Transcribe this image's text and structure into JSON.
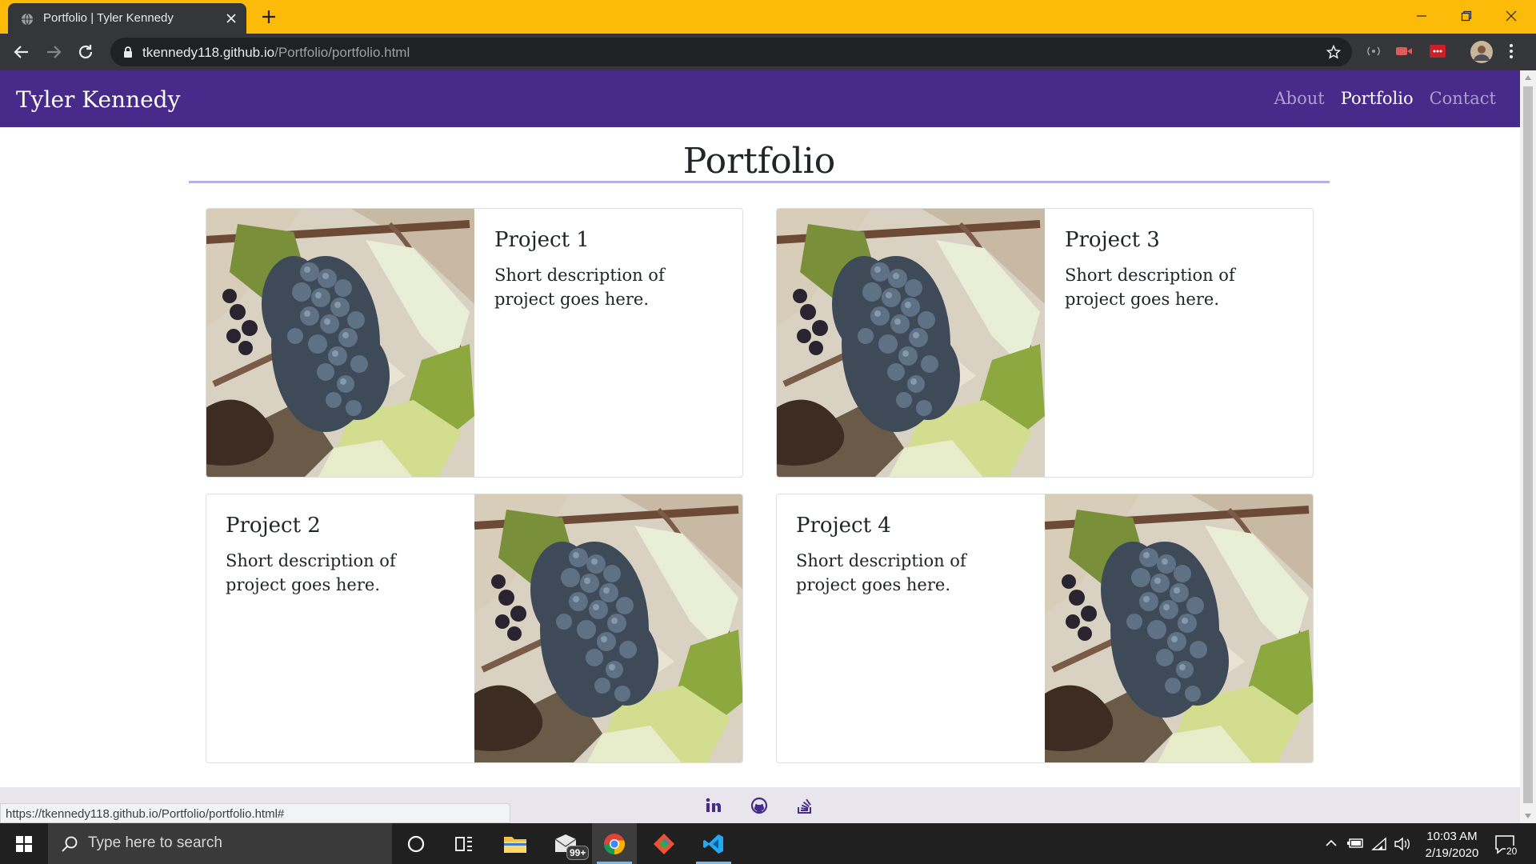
{
  "browser": {
    "tab_title": "Portfolio | Tyler Kennedy",
    "url_host": "tkennedy118.github.io",
    "url_path": "/Portfolio/portfolio.html",
    "theme_color": "#fcbb08",
    "status_url": "https://tkennedy118.github.io/Portfolio/portfolio.html#"
  },
  "site": {
    "brand": "Tyler Kennedy",
    "nav": [
      {
        "label": "About",
        "active": false
      },
      {
        "label": "Portfolio",
        "active": true
      },
      {
        "label": "Contact",
        "active": false
      }
    ],
    "nav_color": "#472a8a"
  },
  "main": {
    "title": "Portfolio",
    "projects": [
      {
        "title": "Project 1",
        "description": "Short description of project goes here.",
        "image": "grapes-photo"
      },
      {
        "title": "Project 3",
        "description": "Short description of project goes here.",
        "image": "grapes-photo"
      },
      {
        "title": "Project 2",
        "description": "Short description of project goes here.",
        "image": "grapes-photo"
      },
      {
        "title": "Project 4",
        "description": "Short description of project goes here.",
        "image": "grapes-photo"
      }
    ]
  },
  "footer": {
    "icons": [
      "linkedin-icon",
      "github-icon",
      "stackoverflow-icon"
    ]
  },
  "taskbar": {
    "search_placeholder": "Type here to search",
    "mail_badge": "99+",
    "time": "10:03 AM",
    "date": "2/19/2020",
    "notification_count": "20"
  }
}
